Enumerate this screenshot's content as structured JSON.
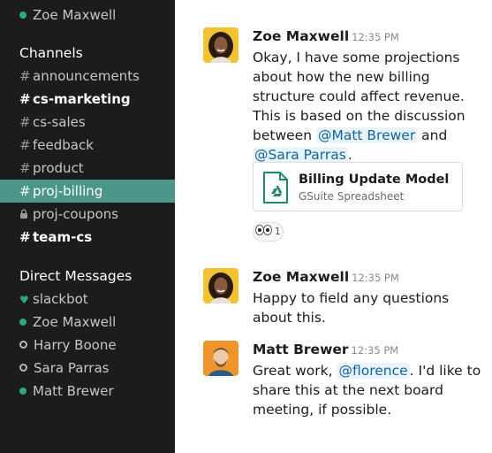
{
  "sidebar": {
    "current_user": "Zoe Maxwell",
    "channels_header": "Channels",
    "channels": [
      {
        "prefix": "#",
        "name": "announcements"
      },
      {
        "prefix": "#",
        "name": "cs-marketing"
      },
      {
        "prefix": "#",
        "name": "cs-sales"
      },
      {
        "prefix": "#",
        "name": "feedback"
      },
      {
        "prefix": "#",
        "name": "product"
      },
      {
        "prefix": "#",
        "name": "proj-billing"
      },
      {
        "prefix": "",
        "name": "proj-coupons"
      },
      {
        "prefix": "#",
        "name": "team-cs"
      }
    ],
    "dm_header": "Direct Messages",
    "dms": [
      {
        "name": "slackbot"
      },
      {
        "name": "Zoe Maxwell"
      },
      {
        "name": "Harry Boone"
      },
      {
        "name": "Sara Parras"
      },
      {
        "name": "Matt Brewer"
      }
    ]
  },
  "messages": [
    {
      "author": "Zoe Maxwell",
      "time": "12:35 PM",
      "lines": [
        "Okay, I have some projections",
        "about how the new billing",
        "structure could affect revenue.",
        "This is based on the discussion",
        "between",
        "@Matt Brewer",
        "and",
        "@Sara Parras",
        "."
      ],
      "attachment": {
        "title": "Billing Update Model",
        "subtitle": "GSuite Spreadsheet"
      },
      "reaction": {
        "count": "1"
      }
    },
    {
      "author": "Zoe Maxwell",
      "time": "12:35 PM",
      "lines": [
        "Happy to field any questions",
        "about this."
      ]
    },
    {
      "author": "Matt Brewer",
      "time": "12:35 PM",
      "lines": [
        "Great work,",
        "@florence",
        ". I'd like to",
        "share this at the next board",
        "meeting, if possible."
      ]
    }
  ],
  "colors": {
    "sidebar_bg": "#1d1c1d",
    "active_channel": "#4c9689",
    "online": "#2bac76",
    "mention": "#1264a3"
  }
}
